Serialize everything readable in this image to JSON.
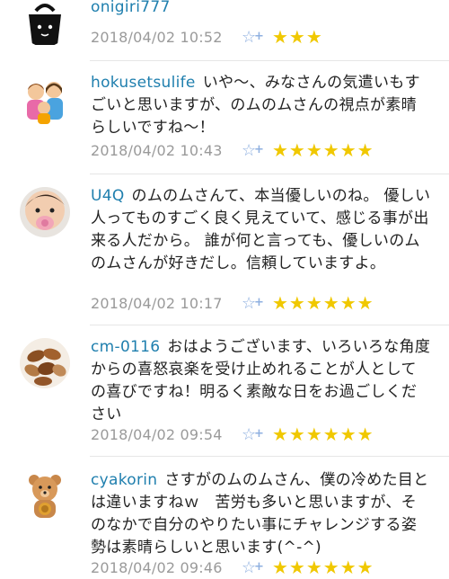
{
  "comments": [
    {
      "username": "onigiri777",
      "text": "",
      "timestamp": "2018/04/02 10:52",
      "star_count": 3,
      "avatar_icon": "onigiri-avatar-icon",
      "star_color": "#f0c800",
      "add_star_icon": "add-star-icon"
    },
    {
      "username": "hokusetsulife",
      "text": "いや〜、みなさんの気遣いもすごいと思いますが、のムのムさんの視点が素晴らしいですね〜！",
      "timestamp": "2018/04/02 10:43",
      "star_count": 6,
      "avatar_icon": "family-avatar-icon",
      "star_color": "#f0c800",
      "add_star_icon": "add-star-icon"
    },
    {
      "username": "U4Q",
      "text": "のムのムさんて、本当優しいのね。 優しい人ってものすごく良く見えていて、感じる事が出来る人だから。 誰が何と言っても、優しいのムのムさんが好きだし。信頼していますよ。",
      "timestamp": "2018/04/02 10:17",
      "star_count": 6,
      "avatar_icon": "baby-avatar-icon",
      "star_color": "#f0c800",
      "add_star_icon": "add-star-icon"
    },
    {
      "username": "cm-0116",
      "text": "おはようございます、いろいろな角度からの喜怒哀楽を受け止めれることが人としての喜びですね！明るく素敵な日をお過ごしください",
      "timestamp": "2018/04/02 09:54",
      "star_count": 6,
      "avatar_icon": "nuts-avatar-icon",
      "star_color": "#f0c800",
      "add_star_icon": "add-star-icon"
    },
    {
      "username": "cyakorin",
      "text": "さすがのムのムさん、僕の冷めた目とは違いますねｗ　苦労も多いと思いますが、そのなかで自分のやりたい事にチャレンジする姿勢は素晴らしいと思います(^-^)",
      "timestamp": "2018/04/02 09:46",
      "star_count": 6,
      "avatar_icon": "bear-avatar-icon",
      "star_color": "#f0c800",
      "add_star_icon": "add-star-icon"
    }
  ],
  "colors": {
    "username": "#1f7fae",
    "timestamp": "#9a9a9a",
    "star": "#f0c800",
    "add_star": "#8fb0e0"
  }
}
